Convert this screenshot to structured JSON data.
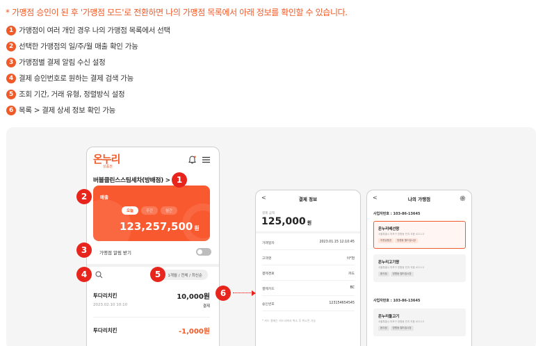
{
  "intro": "* 가맹점 승인이 된 후 '가맹점 모드'로 전환하면 나의 가맹점 목록에서 아래 정보를 확인할 수 있습니다.",
  "steps": [
    {
      "num": "1",
      "text": "가맹점이 여러 개인 경우 나의 가맹점 목록에서 선택"
    },
    {
      "num": "2",
      "text": "선택한 가맹점의 일/주/월 매출 확인 가능"
    },
    {
      "num": "3",
      "text": "가맹점별 결제 알림 수신 설정"
    },
    {
      "num": "4",
      "text": "결제 승인번호로 원하는 결제 검색 가능"
    },
    {
      "num": "5",
      "text": "조회 기간, 거래 유형, 정렬방식 설정"
    },
    {
      "num": "6",
      "text": "목록 > 결제 상세 정보 확인 가능"
    }
  ],
  "phone_main": {
    "logo": "온누리",
    "logo_sub": "상품권",
    "store_title": "버블클린스스팀세차(방배점) >",
    "sales_label": "매출",
    "period_tabs": [
      "오늘",
      "주간",
      "월간"
    ],
    "sales_amount": "123,257,500",
    "sales_unit": "원",
    "alarm_label": "가맹점 알림 받기",
    "alarm_on": false,
    "filter": "1개월 / 전체 / 최신순",
    "transactions": [
      {
        "name": "투다리치킨",
        "amount": "10,000원",
        "date": "2023.02.10 10:10",
        "status": "결제"
      },
      {
        "name": "투다리치킨",
        "amount": "-1,000원"
      }
    ]
  },
  "phone_detail": {
    "title": "결제 정보",
    "amount_label": "결제 금액",
    "amount": "125,000",
    "unit": "원",
    "rows": [
      {
        "k": "거래일자",
        "v": "2023.01.15 12:10:45"
      },
      {
        "k": "고객명",
        "v": "이*현"
      },
      {
        "k": "결제경로",
        "v": "카드"
      },
      {
        "k": "결제카드",
        "v": "BC"
      },
      {
        "k": "승인번호",
        "v": "123154654545"
      }
    ],
    "note": "* 카드 결제는 카드사에서 취소 후 취소된 가능"
  },
  "phone_stores": {
    "title": "나의 가맹점",
    "groups": [
      {
        "bizno": "사업자번호 : 103-86-13645",
        "stores": [
          {
            "name": "온누리베선왕",
            "addr": "서울특별시 마포구 망원동 빈지 지음 423-13",
            "tags": [
              "지류상품권",
              "망원동 월드컵시장"
            ]
          },
          {
            "name": "온누리고기왕",
            "addr": "서울특별시 마포구 망원동 빈지 지음 423-13",
            "tags": [
              "음식점",
              "망원동 월드컵시장"
            ]
          }
        ]
      },
      {
        "bizno": "사업자번호 : 103-86-13645",
        "stores": [
          {
            "name": "온누리돌고기",
            "addr": "서울특별시 마포구 망원동 빈지 지음 423-13",
            "tags": [
              "음식점",
              "망원동 월드컵시장"
            ]
          }
        ]
      }
    ]
  },
  "markers": [
    "1",
    "2",
    "3",
    "4",
    "5",
    "6"
  ],
  "colors": {
    "accent": "#f05a28",
    "card": "#f9592f",
    "marker": "#e8251d"
  }
}
